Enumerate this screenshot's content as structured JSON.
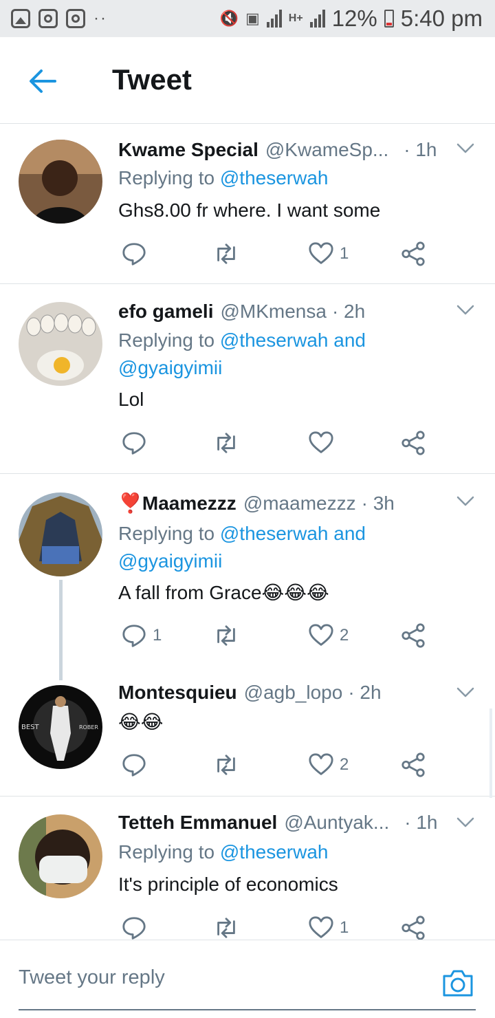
{
  "status_bar": {
    "battery": "12%",
    "time": "5:40 pm",
    "net": "H+"
  },
  "header": {
    "title": "Tweet"
  },
  "tweets": [
    {
      "name": "Kwame Special",
      "handle": "@KwameSp...",
      "time": "· 1h",
      "replying_prefix": "Replying to ",
      "replying_to": "@theserwah",
      "replying_more": "",
      "text": "Ghs8.00 fr where. I want some",
      "replies": "",
      "retweets": "",
      "likes": "1"
    },
    {
      "name": "efo gameli",
      "handle": "@MKmensa",
      "time": "· 2h",
      "replying_prefix": "Replying to ",
      "replying_to": "@theserwah and",
      "replying_more": "@gyaigyimii",
      "text": "Lol",
      "replies": "",
      "retweets": "",
      "likes": ""
    },
    {
      "name": "❣️Maamezzz",
      "handle": "@maamezzz",
      "time": "· 3h",
      "replying_prefix": "Replying to ",
      "replying_to": "@theserwah and",
      "replying_more": "@gyaigyimii",
      "text": "A fall from  Grace😂😂😂",
      "replies": "1",
      "retweets": "",
      "likes": "2"
    },
    {
      "name": "Montesquieu",
      "handle": "@agb_lopo",
      "time": "· 2h",
      "text": "😂😂",
      "replies": "",
      "retweets": "",
      "likes": "2"
    },
    {
      "name": "Tetteh Emmanuel",
      "handle": "@Auntyak...",
      "time": "· 1h",
      "replying_prefix": "Replying to ",
      "replying_to": "@theserwah",
      "replying_more": "",
      "text": "It's principle of economics",
      "replies": "",
      "retweets": "",
      "likes": "1"
    }
  ],
  "reply_bar": {
    "placeholder": "Tweet your reply"
  },
  "colors": {
    "accent": "#1b95e0",
    "muted": "#657786",
    "text": "#14171a",
    "divider": "#dfe3e6"
  },
  "icons": [
    "back-arrow-icon",
    "chevron-down-icon",
    "reply-icon",
    "retweet-icon",
    "like-icon",
    "share-icon",
    "camera-icon"
  ]
}
